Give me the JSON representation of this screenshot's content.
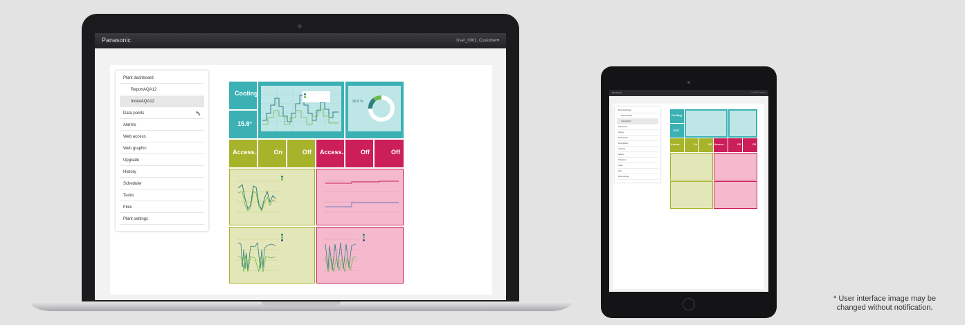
{
  "app": {
    "brand": "Panasonic",
    "user_menu": "User_0001, Customer▾"
  },
  "sidebar": {
    "items": [
      {
        "label": "Plant dashboard",
        "sub": false,
        "selected": false
      },
      {
        "label": "ReportAQA12",
        "sub": true,
        "selected": false
      },
      {
        "label": "IndexAQA12",
        "sub": true,
        "selected": true
      },
      {
        "label": "Data points",
        "sub": false,
        "selected": false,
        "icon": "rss-icon"
      },
      {
        "label": "Alarms",
        "sub": false,
        "selected": false
      },
      {
        "label": "Web access",
        "sub": false,
        "selected": false
      },
      {
        "label": "Web graphic",
        "sub": false,
        "selected": false
      },
      {
        "label": "Upgrade",
        "sub": false,
        "selected": false
      },
      {
        "label": "History",
        "sub": false,
        "selected": false
      },
      {
        "label": "Scheduler",
        "sub": false,
        "selected": false
      },
      {
        "label": "Tasks",
        "sub": false,
        "selected": false
      },
      {
        "label": "Files",
        "sub": false,
        "selected": false
      },
      {
        "label": "Plant settings",
        "sub": false,
        "selected": false
      }
    ]
  },
  "dashboard": {
    "mode_tile": {
      "value": "Cooling"
    },
    "temp_tile": {
      "value": "15.8°"
    },
    "gauge_tile": {
      "value": "26.6 %"
    },
    "status_tiles": [
      {
        "value": "Access...",
        "color": "#a7b32a"
      },
      {
        "value": "On",
        "color": "#a7b32a"
      },
      {
        "value": "Off",
        "color": "#a7b32a"
      },
      {
        "value": "Access...",
        "color": "#cc1f5a"
      },
      {
        "value": "Off",
        "color": "#cc1f5a"
      },
      {
        "value": "Off",
        "color": "#cc1f5a"
      }
    ],
    "colors": {
      "teal": "#3bb1b3",
      "olive": "#a7b32a",
      "magenta": "#cc1f5a",
      "olive_bg": "#e3e6b8",
      "pink_bg": "#f4b9cc",
      "teal_bg": "#bfe6e7"
    }
  },
  "footnote": {
    "line1": "* User interface image may be",
    "line2": "changed without notification."
  }
}
